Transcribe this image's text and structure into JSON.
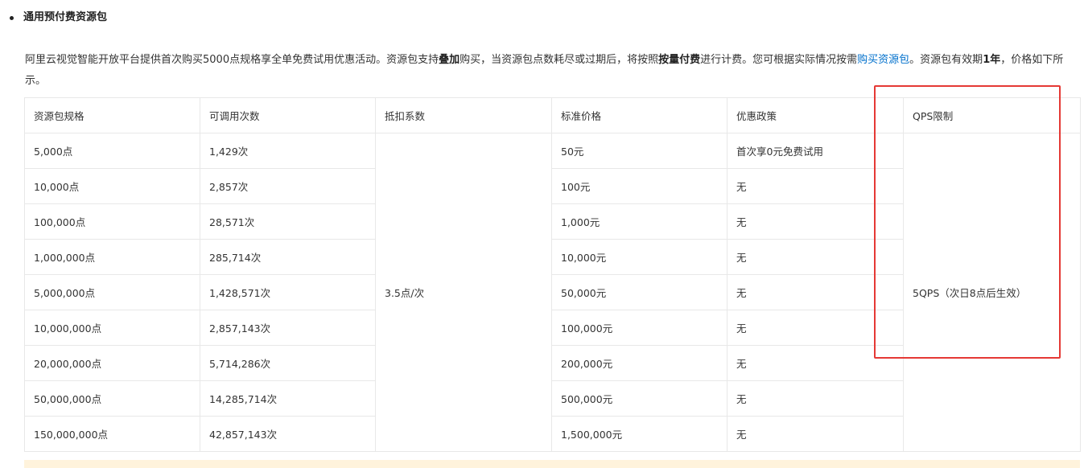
{
  "section": {
    "title": "通用预付费资源包"
  },
  "intro": {
    "part1": "阿里云视觉智能开放平台提供首次购买5000点规格享全单免费试用优惠活动。资源包支持",
    "bold1": "叠加",
    "part2": "购买，当资源包点数耗尽或过期后，将按照",
    "bold2": "按量付费",
    "part3": "进行计费。您可根据实际情况按需",
    "link": "购买资源包",
    "part4": "。资源包有效期",
    "bold3": "1年",
    "part5": "，价格如下所示。"
  },
  "table": {
    "headers": [
      "资源包规格",
      "可调用次数",
      "抵扣系数",
      "标准价格",
      "优惠政策",
      "QPS限制"
    ],
    "deduction": "3.5点/次",
    "qps": "5QPS（次日8点后生效）",
    "rows": [
      {
        "spec": "5,000点",
        "calls": "1,429次",
        "price": "50元",
        "discount": "首次享0元免费试用"
      },
      {
        "spec": "10,000点",
        "calls": "2,857次",
        "price": "100元",
        "discount": "无"
      },
      {
        "spec": "100,000点",
        "calls": "28,571次",
        "price": "1,000元",
        "discount": "无"
      },
      {
        "spec": "1,000,000点",
        "calls": "285,714次",
        "price": "10,000元",
        "discount": "无"
      },
      {
        "spec": "5,000,000点",
        "calls": "1,428,571次",
        "price": "50,000元",
        "discount": "无"
      },
      {
        "spec": "10,000,000点",
        "calls": "2,857,143次",
        "price": "100,000元",
        "discount": "无"
      },
      {
        "spec": "20,000,000点",
        "calls": "5,714,286次",
        "price": "200,000元",
        "discount": "无"
      },
      {
        "spec": "50,000,000点",
        "calls": "14,285,714次",
        "price": "500,000元",
        "discount": "无"
      },
      {
        "spec": "150,000,000点",
        "calls": "42,857,143次",
        "price": "1,500,000元",
        "discount": "无"
      }
    ]
  },
  "colors": {
    "highlight": "#e53935",
    "link": "#0070cc",
    "note_bg": "#fff3dc"
  }
}
